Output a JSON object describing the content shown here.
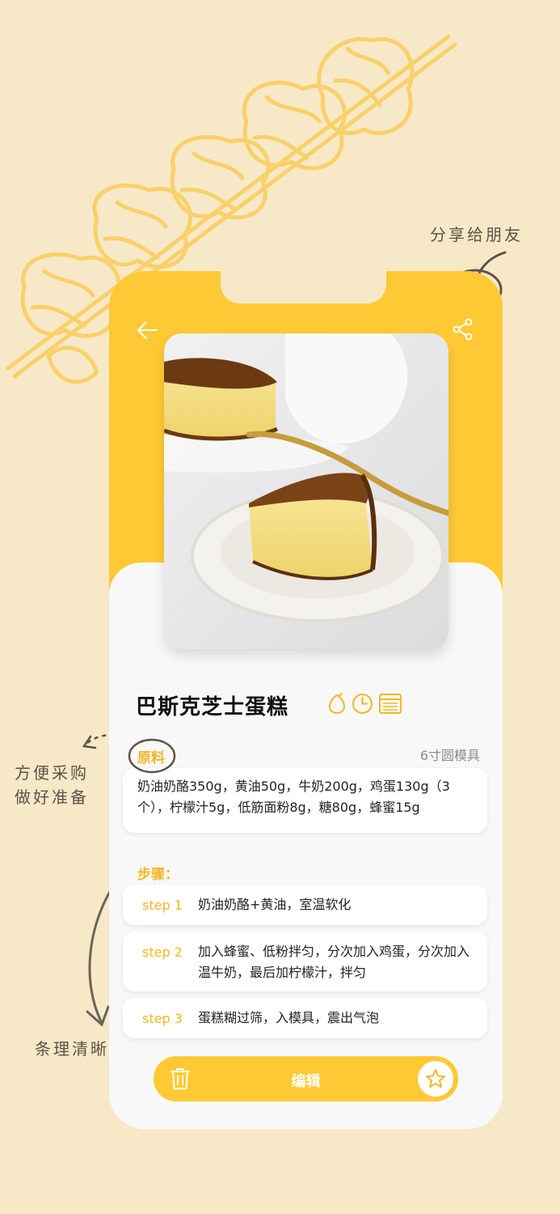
{
  "annotations": {
    "share": "分享给朋友",
    "shopping_line1": "方便采购",
    "shopping_line2": "做好准备",
    "clear": "条理清晰"
  },
  "header": {
    "back_icon": "arrow-left-icon",
    "share_icon": "share-icon"
  },
  "recipe": {
    "title": "巴斯克芝士蛋糕",
    "icons": [
      "egg-icon",
      "clock-icon",
      "oven-icon"
    ],
    "ingredients_label": "原料",
    "mold": "6寸圆模具",
    "ingredients": "奶油奶酪350g，黄油50g，牛奶200g，鸡蛋130g（3个），柠檬汁5g，低筋面粉8g，糖80g，蜂蜜15g",
    "steps_label": "步骤：",
    "steps": [
      {
        "num": "step 1",
        "text": "奶油奶酪+黄油，室温软化"
      },
      {
        "num": "step 2",
        "text": "加入蜂蜜、低粉拌匀，分次加入鸡蛋，分次加入温牛奶，最后加柠檬汁，拌匀"
      },
      {
        "num": "step 3",
        "text": "蛋糕糊过筛，入模具，震出气泡"
      }
    ]
  },
  "bottom_bar": {
    "edit_label": "编辑",
    "delete_icon": "trash-icon",
    "favorite_icon": "star-icon"
  },
  "colors": {
    "accent": "#fec934",
    "background": "#f7e9c7",
    "label": "#f2b824"
  }
}
